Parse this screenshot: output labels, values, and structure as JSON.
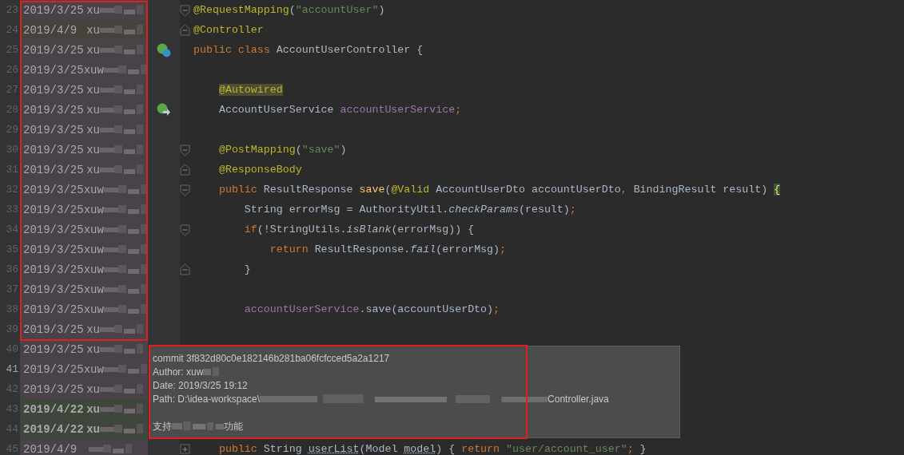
{
  "editor": {
    "lines": [
      {
        "number": "23",
        "current": false,
        "blame": {
          "date": "2019/3/25",
          "author": "xu",
          "color": "#4a4249",
          "bold": false
        },
        "fold": {
          "kind": "start"
        },
        "tokens": [
          {
            "text": "@RequestMapping",
            "kind": "annotation"
          },
          {
            "text": "(",
            "kind": "plain"
          },
          {
            "text": "\"accountUser\"",
            "kind": "string"
          },
          {
            "text": ")",
            "kind": "plain"
          }
        ]
      },
      {
        "number": "24",
        "current": false,
        "blame": {
          "date": "2019/4/9",
          "author": "xu",
          "color": "#45433b",
          "bold": false
        },
        "fold": {
          "kind": "end"
        },
        "tokens": [
          {
            "text": "@Controller",
            "kind": "annotation"
          }
        ]
      },
      {
        "number": "25",
        "current": false,
        "blame": {
          "date": "2019/3/25",
          "author": "xu",
          "color": "#4a4249",
          "bold": false
        },
        "gutter_icon": {
          "kind": "bean"
        },
        "tokens": [
          {
            "text": "public class ",
            "kind": "keyword"
          },
          {
            "text": "AccountUserController {",
            "kind": "plain"
          }
        ]
      },
      {
        "number": "26",
        "current": false,
        "blame": {
          "date": "2019/3/25",
          "author": "xuw",
          "color": "#4a4249",
          "bold": false
        }
      },
      {
        "number": "27",
        "current": false,
        "blame": {
          "date": "2019/3/25",
          "author": "xu",
          "color": "#4a4249",
          "bold": false
        },
        "tokens": [
          {
            "text": "    @Autowired",
            "kind": "annotation-marked"
          }
        ]
      },
      {
        "number": "28",
        "current": false,
        "blame": {
          "date": "2019/3/25",
          "author": "xu",
          "color": "#4a4249",
          "bold": false
        },
        "gutter_icon": {
          "kind": "autowire"
        },
        "tokens": [
          {
            "text": "    AccountUserService ",
            "kind": "plain"
          },
          {
            "text": "accountUserService",
            "kind": "field"
          },
          {
            "text": ";",
            "kind": "punct"
          }
        ]
      },
      {
        "number": "29",
        "current": false,
        "blame": {
          "date": "2019/3/25",
          "author": "xu",
          "color": "#4a4249",
          "bold": false
        }
      },
      {
        "number": "30",
        "current": false,
        "blame": {
          "date": "2019/3/25",
          "author": "xu",
          "color": "#4a4249",
          "bold": false
        },
        "fold": {
          "kind": "start"
        },
        "tokens": [
          {
            "text": "    @PostMapping",
            "kind": "annotation"
          },
          {
            "text": "(",
            "kind": "plain"
          },
          {
            "text": "\"save\"",
            "kind": "string"
          },
          {
            "text": ")",
            "kind": "plain"
          }
        ]
      },
      {
        "number": "31",
        "current": false,
        "blame": {
          "date": "2019/3/25",
          "author": "xu",
          "color": "#4a4249",
          "bold": false
        },
        "fold": {
          "kind": "end"
        },
        "tokens": [
          {
            "text": "    @ResponseBody",
            "kind": "annotation"
          }
        ]
      },
      {
        "number": "32",
        "current": false,
        "blame": {
          "date": "2019/3/25",
          "author": "xuw",
          "color": "#4a4249",
          "bold": false
        },
        "fold": {
          "kind": "start"
        },
        "tokens": [
          {
            "text": "    public ",
            "kind": "keyword"
          },
          {
            "text": "ResultResponse ",
            "kind": "plain"
          },
          {
            "text": "save",
            "kind": "method"
          },
          {
            "text": "(",
            "kind": "plain"
          },
          {
            "text": "@Valid ",
            "kind": "annotation"
          },
          {
            "text": "AccountUserDto accountUserDto",
            "kind": "plain"
          },
          {
            "text": ", ",
            "kind": "punct"
          },
          {
            "text": "BindingResult result) ",
            "kind": "plain"
          },
          {
            "text": "{",
            "kind": "brace-marked"
          }
        ]
      },
      {
        "number": "33",
        "current": false,
        "blame": {
          "date": "2019/3/25",
          "author": "xuw",
          "color": "#4a4249",
          "bold": false
        },
        "tokens": [
          {
            "text": "        String errorMsg = AuthorityUtil.",
            "kind": "plain"
          },
          {
            "text": "checkParams",
            "kind": "static"
          },
          {
            "text": "(result)",
            "kind": "plain"
          },
          {
            "text": ";",
            "kind": "punct"
          }
        ]
      },
      {
        "number": "34",
        "current": false,
        "blame": {
          "date": "2019/3/25",
          "author": "xuw",
          "color": "#4a4249",
          "bold": false
        },
        "fold": {
          "kind": "start"
        },
        "tokens": [
          {
            "text": "        if",
            "kind": "keyword"
          },
          {
            "text": "(!StringUtils.",
            "kind": "plain"
          },
          {
            "text": "isBlank",
            "kind": "static"
          },
          {
            "text": "(errorMsg)) {",
            "kind": "plain"
          }
        ]
      },
      {
        "number": "35",
        "current": false,
        "blame": {
          "date": "2019/3/25",
          "author": "xuw",
          "color": "#4a4249",
          "bold": false
        },
        "tokens": [
          {
            "text": "            return ",
            "kind": "keyword"
          },
          {
            "text": "ResultResponse.",
            "kind": "plain"
          },
          {
            "text": "fail",
            "kind": "static"
          },
          {
            "text": "(errorMsg)",
            "kind": "plain"
          },
          {
            "text": ";",
            "kind": "punct"
          }
        ]
      },
      {
        "number": "36",
        "current": false,
        "blame": {
          "date": "2019/3/25",
          "author": "xuw",
          "color": "#4a4249",
          "bold": false
        },
        "fold": {
          "kind": "end"
        },
        "tokens": [
          {
            "text": "        }",
            "kind": "plain"
          }
        ]
      },
      {
        "number": "37",
        "current": false,
        "blame": {
          "date": "2019/3/25",
          "author": "xuw",
          "color": "#4a4249",
          "bold": false
        }
      },
      {
        "number": "38",
        "current": false,
        "blame": {
          "date": "2019/3/25",
          "author": "xuw",
          "color": "#4a4249",
          "bold": false
        },
        "tokens": [
          {
            "text": "        accountUserService",
            "kind": "field"
          },
          {
            "text": ".save(accountUserDto)",
            "kind": "plain"
          },
          {
            "text": ";",
            "kind": "punct"
          }
        ]
      },
      {
        "number": "39",
        "current": false,
        "blame": {
          "date": "2019/3/25",
          "author": "xu",
          "color": "#4a4249",
          "bold": false
        }
      },
      {
        "number": "40",
        "current": false,
        "blame": {
          "date": "2019/3/25",
          "author": "xu",
          "color": "#4a4249",
          "bold": false
        }
      },
      {
        "number": "41",
        "current": true,
        "blame": {
          "date": "2019/3/25",
          "author": "xuw",
          "color": "#4a4249",
          "bold": false
        }
      },
      {
        "number": "42",
        "current": false,
        "blame": {
          "date": "2019/3/25",
          "author": "xu",
          "color": "#4a4249",
          "bold": false
        }
      },
      {
        "number": "43",
        "current": false,
        "blame": {
          "date": "2019/4/22",
          "author": "xu",
          "color": "#3f463b",
          "bold": true
        }
      },
      {
        "number": "44",
        "current": false,
        "blame": {
          "date": "2019/4/22",
          "author": "xu",
          "color": "#3f463b",
          "bold": true
        }
      },
      {
        "number": "45",
        "current": false,
        "blame": {
          "date": "2019/4/9",
          "color": "#4a4249",
          "bold": false
        },
        "fold": {
          "kind": "collapsed"
        },
        "tokens": [
          {
            "text": "    public ",
            "kind": "keyword"
          },
          {
            "text": "String ",
            "kind": "plain"
          },
          {
            "text": "userList",
            "kind": "underlined"
          },
          {
            "text": "(Model ",
            "kind": "plain"
          },
          {
            "text": "model",
            "kind": "underlined"
          },
          {
            "text": ") { ",
            "kind": "plain"
          },
          {
            "text": "return ",
            "kind": "keyword"
          },
          {
            "text": "\"user/account_user\"",
            "kind": "string"
          },
          {
            "text": "; ",
            "kind": "punct"
          },
          {
            "text": "}",
            "kind": "plain"
          }
        ]
      }
    ]
  },
  "tooltip": {
    "lines": [
      {
        "segments": [
          "commit 3f832d80c0e182146b281ba06fcfcced5a2a1217"
        ]
      },
      {
        "segments": [
          "Author: xuw"
        ],
        "redacted_end": true
      },
      {
        "segments": [
          "Date: 2019/3/25 19:12"
        ]
      },
      {
        "segments": [
          "Path: D:\\idea-workspace\\",
          "Controller.java"
        ]
      },
      {
        "segments": [
          "支持",
          "功能"
        ],
        "gap_before": true
      }
    ]
  }
}
